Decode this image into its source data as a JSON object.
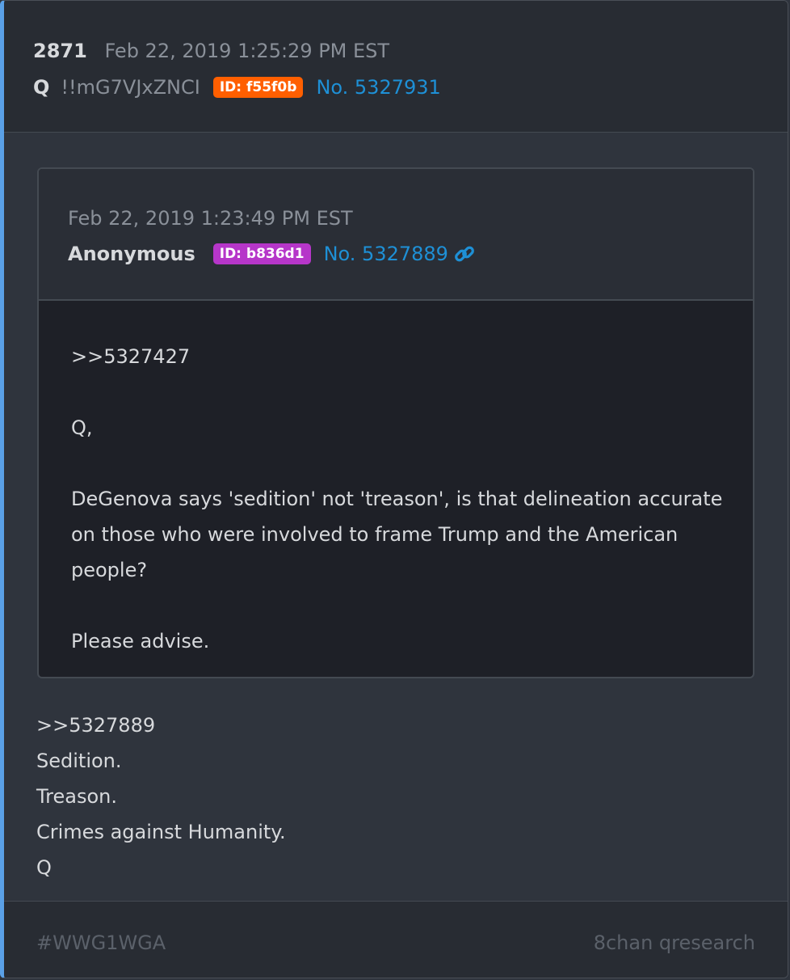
{
  "post": {
    "number": "2871",
    "datetime": "Feb 22, 2019 1:25:29 PM EST",
    "author": "Q",
    "tripcode": "!!mG7VJxZNCI",
    "id_badge": "ID: f55f0b",
    "id_color": "#ff5f00",
    "post_no": "No. 5327931"
  },
  "quoted": {
    "datetime": "Feb 22, 2019 1:23:49 PM EST",
    "author": "Anonymous",
    "id_badge": "ID: b836d1",
    "id_color": "#b636c9",
    "post_no": "No. 5327889",
    "link_icon": "link-icon",
    "body": [
      ">>5327427",
      "Q,",
      "DeGenova says 'sedition' not 'treason', is that delineation accurate on those who were involved to frame Trump and the American people?",
      "Please advise."
    ]
  },
  "reply": {
    "lines": [
      ">>5327889",
      "Sedition.",
      "Treason.",
      "Crimes against Humanity.",
      "Q"
    ]
  },
  "footer": {
    "hashtag": "#WWG1WGA",
    "source": "8chan qresearch"
  },
  "colors": {
    "accent_border": "#5aa0e6",
    "link": "#1e90d6"
  }
}
